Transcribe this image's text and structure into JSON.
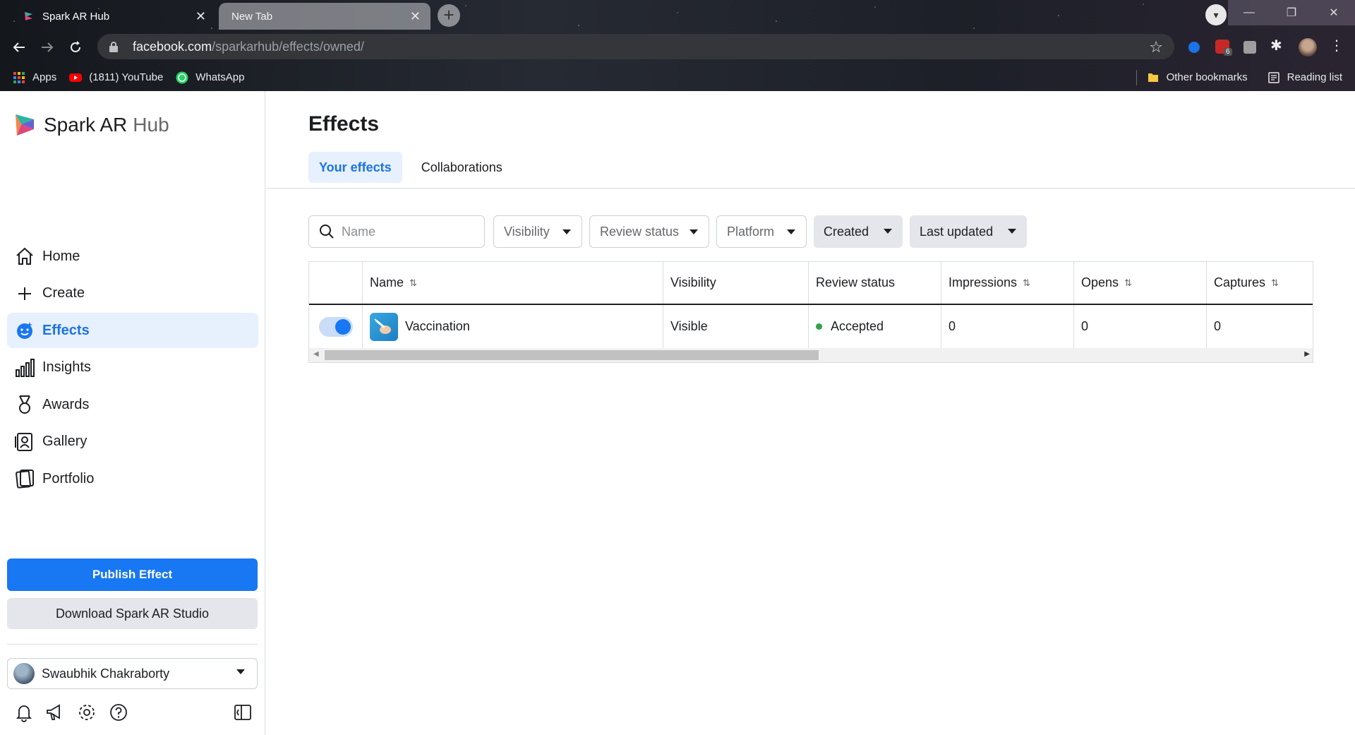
{
  "browser": {
    "tabs": [
      {
        "title": "Spark AR Hub",
        "active": true
      },
      {
        "title": "New Tab",
        "active": false
      }
    ],
    "url": {
      "host": "facebook.com",
      "path": "/sparkarhub/effects/owned/"
    },
    "bookmarks": [
      "Apps",
      "(1811) YouTube",
      "WhatsApp"
    ],
    "bookmarks_right": [
      "Other bookmarks",
      "Reading list"
    ],
    "extension_badge": "6"
  },
  "sidebar": {
    "brand_main": "Spark AR",
    "brand_hub": "Hub",
    "items": [
      {
        "label": "Home",
        "icon": "home-icon",
        "active": false
      },
      {
        "label": "Create",
        "icon": "plus-icon",
        "active": false
      },
      {
        "label": "Effects",
        "icon": "effects-icon",
        "active": true
      },
      {
        "label": "Insights",
        "icon": "bar-chart-icon",
        "active": false
      },
      {
        "label": "Awards",
        "icon": "award-icon",
        "active": false
      },
      {
        "label": "Gallery",
        "icon": "gallery-icon",
        "active": false
      },
      {
        "label": "Portfolio",
        "icon": "portfolio-icon",
        "active": false
      }
    ],
    "publish_label": "Publish Effect",
    "download_label": "Download Spark AR Studio",
    "account_name": "Swaubhik Chakraborty"
  },
  "main": {
    "title": "Effects",
    "tabs": [
      {
        "label": "Your effects",
        "active": true
      },
      {
        "label": "Collaborations",
        "active": false
      }
    ],
    "search_placeholder": "Name",
    "filters": [
      "Visibility",
      "Review status",
      "Platform"
    ],
    "sorts": [
      "Created",
      "Last updated"
    ],
    "columns": [
      "Name",
      "Visibility",
      "Review status",
      "Impressions",
      "Opens",
      "Captures"
    ],
    "rows": [
      {
        "name": "Vaccination",
        "visibility": "Visible",
        "review_status": "Accepted",
        "impressions": "0",
        "opens": "0",
        "captures": "0",
        "enabled": true
      }
    ]
  },
  "colors": {
    "accent": "#1877f2",
    "active_bg": "#e7f0fd",
    "status_accepted": "#31a24c"
  }
}
